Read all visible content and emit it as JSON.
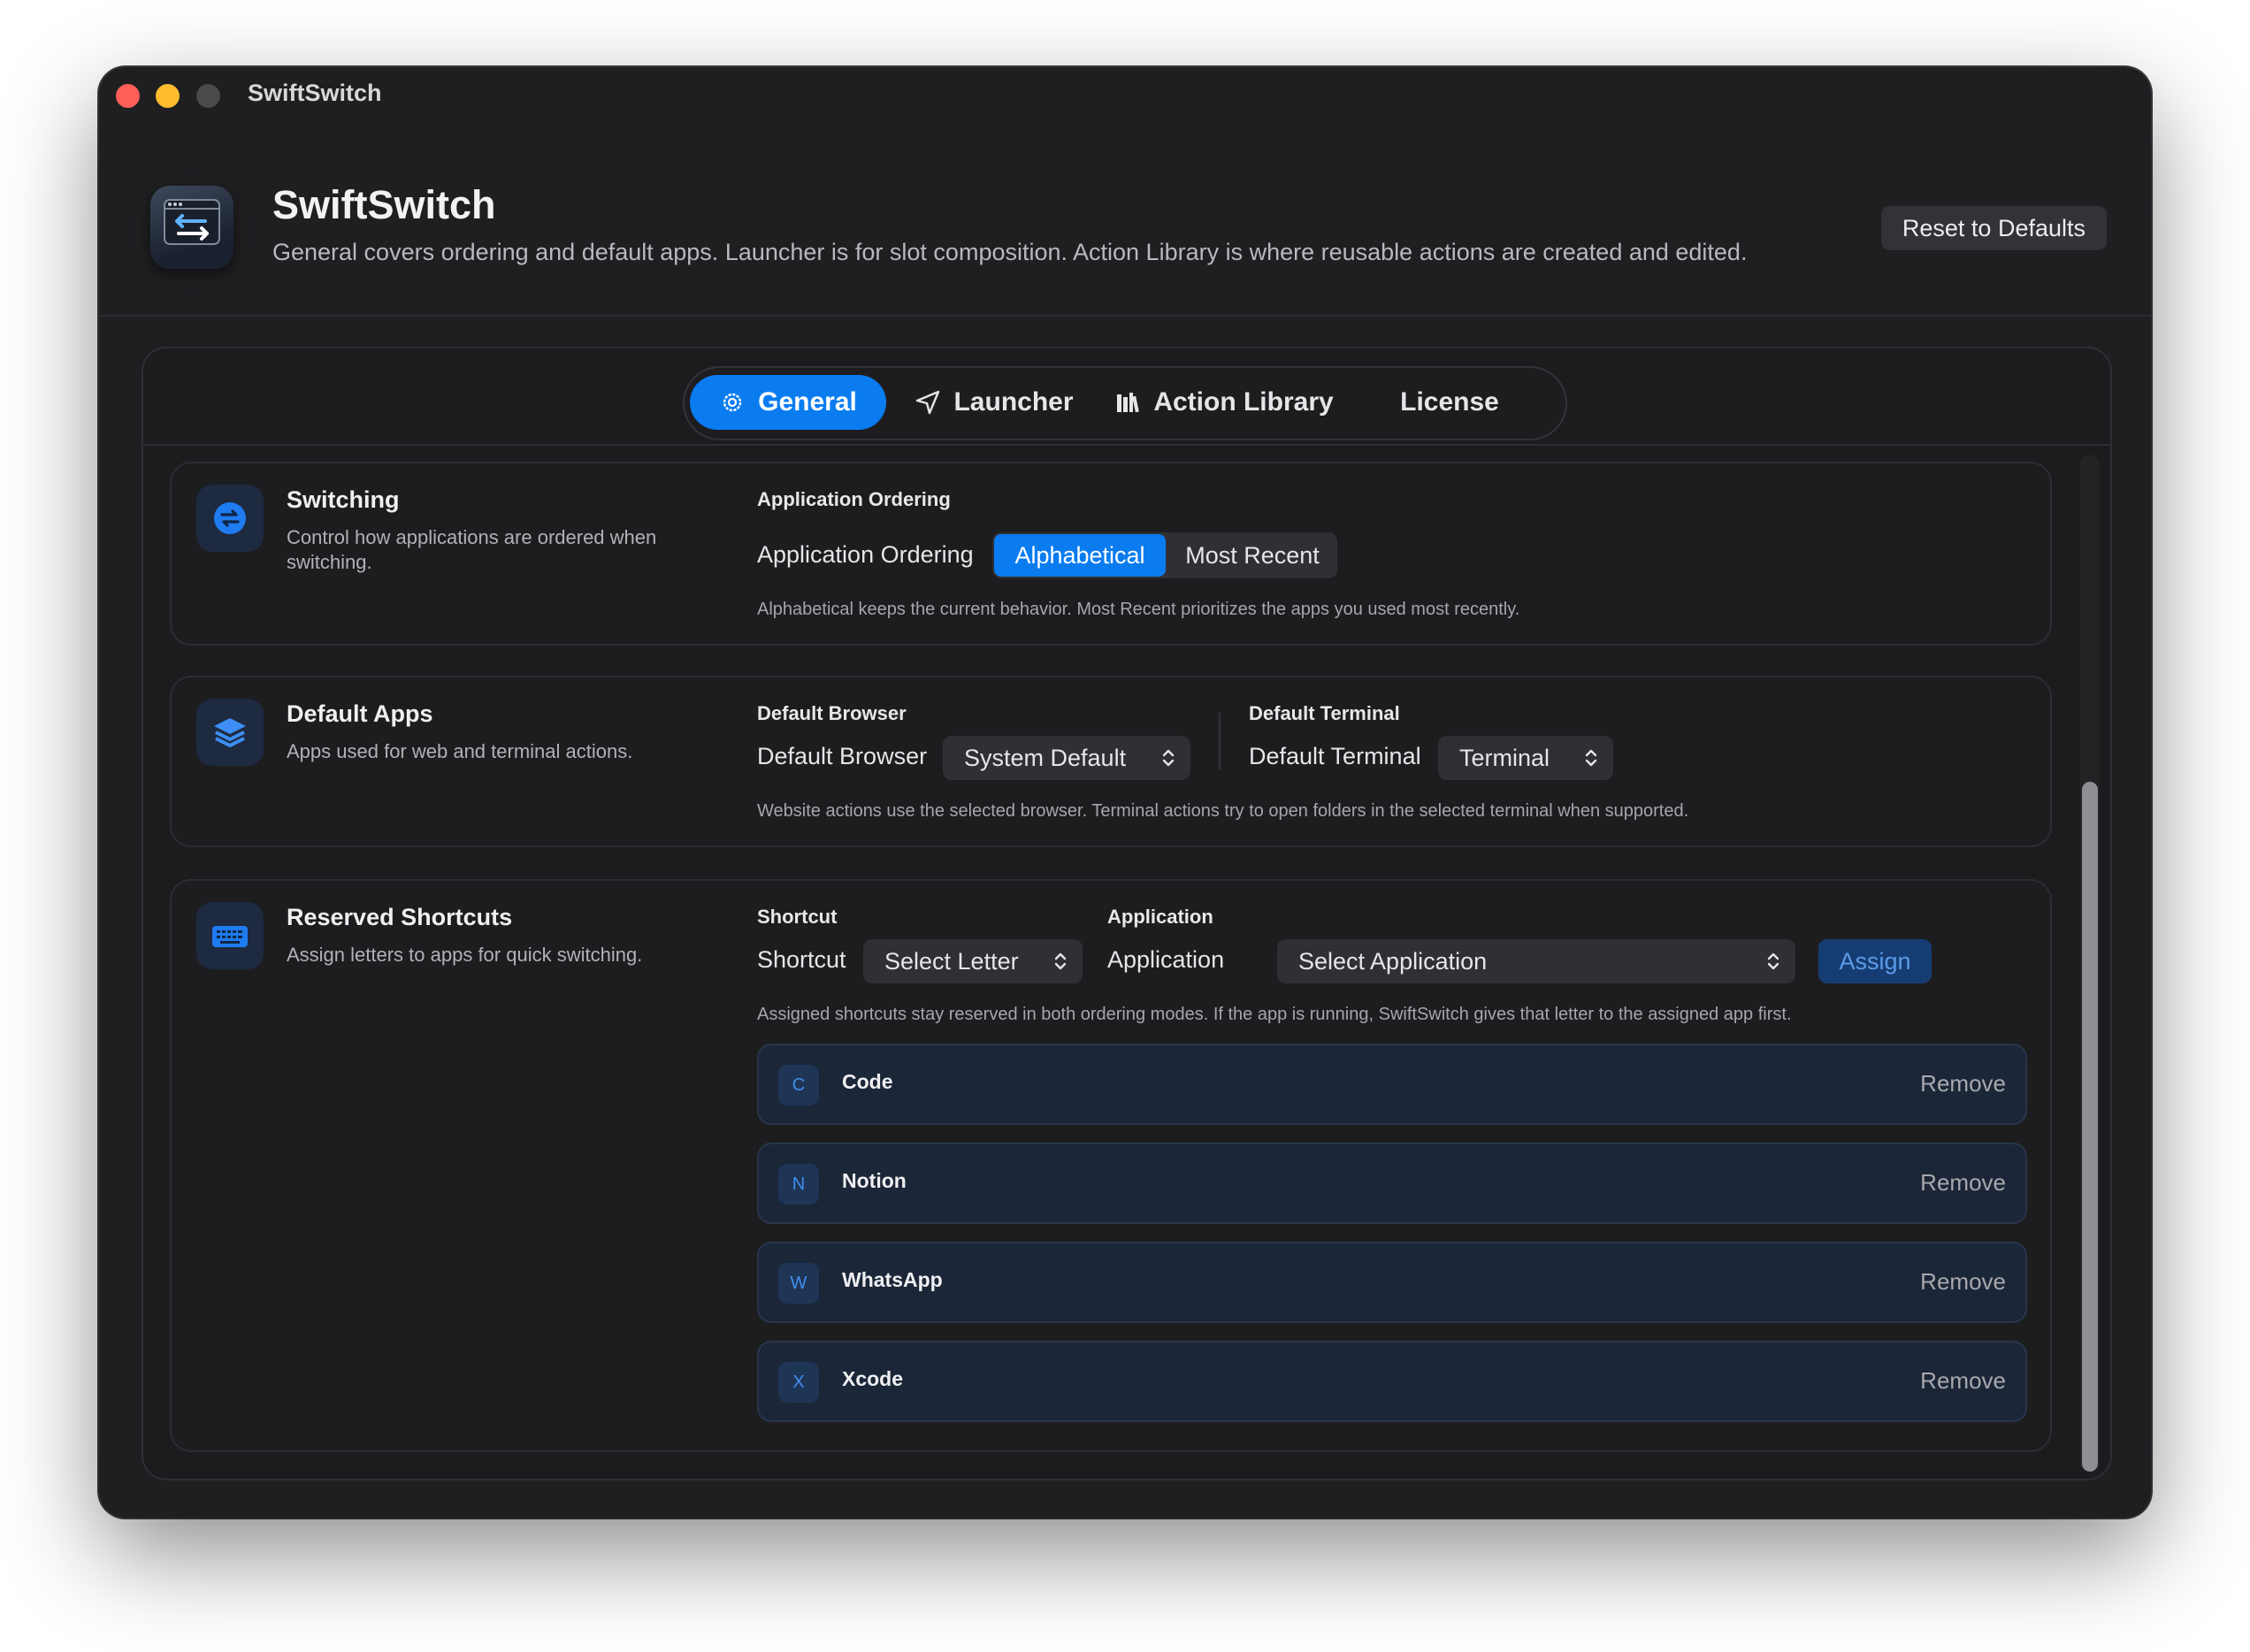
{
  "window": {
    "title": "SwiftSwitch",
    "controls": [
      "close",
      "minimize",
      "zoom"
    ]
  },
  "header": {
    "app_name": "SwiftSwitch",
    "description": "General covers ordering and default apps. Launcher is for slot composition. Action Library is where reusable actions are created and edited.",
    "reset_label": "Reset to Defaults",
    "app_icon": "swiftswitch-app-icon"
  },
  "tabs": [
    {
      "label": "General",
      "icon": "gear-icon",
      "active": true
    },
    {
      "label": "Launcher",
      "icon": "paper-plane-icon",
      "active": false
    },
    {
      "label": "Action Library",
      "icon": "books-icon",
      "active": false
    },
    {
      "label": "License",
      "icon": "",
      "active": false
    }
  ],
  "switching": {
    "title": "Switching",
    "subtitle": "Control how applications are ordered when switching.",
    "icon": "switch-arrows-icon",
    "section_label": "Application Ordering",
    "field_label": "Application Ordering",
    "options": [
      "Alphabetical",
      "Most Recent"
    ],
    "selected": "Alphabetical",
    "hint": "Alphabetical keeps the current behavior. Most Recent prioritizes the apps you used most recently."
  },
  "default_apps": {
    "title": "Default Apps",
    "subtitle": "Apps used for web and terminal actions.",
    "icon": "layers-icon",
    "browser_section": "Default Browser",
    "browser_label": "Default Browser",
    "browser_value": "System Default",
    "terminal_section": "Default Terminal",
    "terminal_label": "Default Terminal",
    "terminal_value": "Terminal",
    "hint": "Website actions use the selected browser. Terminal actions try to open folders in the selected terminal when supported."
  },
  "reserved_shortcuts": {
    "title": "Reserved Shortcuts",
    "subtitle": "Assign letters to apps for quick switching.",
    "icon": "keyboard-icon",
    "shortcut_section": "Shortcut",
    "shortcut_label": "Shortcut",
    "shortcut_value": "Select Letter",
    "application_section": "Application",
    "application_label": "Application",
    "application_value": "Select Application",
    "assign_label": "Assign",
    "hint": "Assigned shortcuts stay reserved in both ordering modes. If the app is running, SwiftSwitch gives that letter to the assigned app first.",
    "items": [
      {
        "letter": "C",
        "app": "Code",
        "action": "Remove"
      },
      {
        "letter": "N",
        "app": "Notion",
        "action": "Remove"
      },
      {
        "letter": "W",
        "app": "WhatsApp",
        "action": "Remove"
      },
      {
        "letter": "X",
        "app": "Xcode",
        "action": "Remove"
      }
    ]
  },
  "colors": {
    "accent": "#0a7cf0",
    "window_bg": "#1f1f22",
    "card_bg": "#1d1d20",
    "shortcut_row_bg": "#1b2638",
    "assign_bg": "#163d73"
  }
}
